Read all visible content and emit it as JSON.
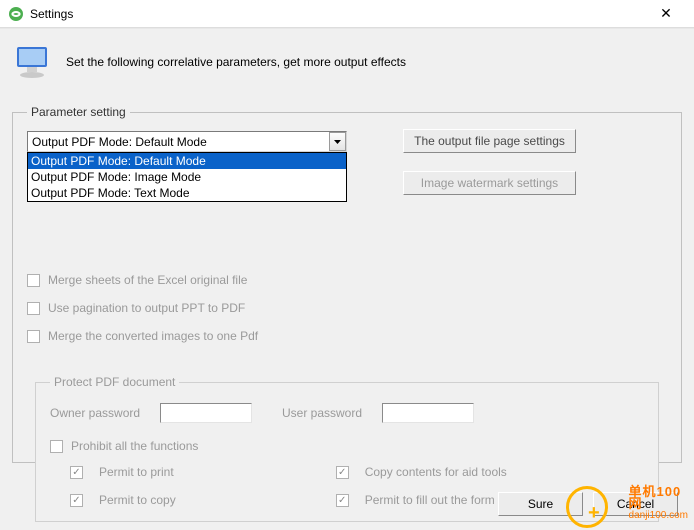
{
  "window": {
    "title": "Settings"
  },
  "header": {
    "description": "Set the following correlative parameters, get more output effects"
  },
  "group": {
    "legend": "Parameter setting",
    "combo": {
      "selected": "Output PDF Mode: Default Mode",
      "options": [
        "Output PDF Mode: Default Mode",
        "Output PDF Mode: Image Mode",
        "Output PDF Mode: Text Mode"
      ]
    },
    "page_settings_btn": "The output file page settings",
    "watermark_btn": "Image watermark settings",
    "checks": {
      "merge_sheets": "Merge sheets of the Excel original file",
      "pagination": "Use pagination to output PPT to PDF",
      "merge_images": "Merge the converted images to one Pdf"
    }
  },
  "protect": {
    "legend": "Protect PDF document",
    "owner_label": "Owner password",
    "user_label": "User password",
    "prohibit": "Prohibit all the functions",
    "permit_print": "Permit to print",
    "permit_copy": "Permit to copy",
    "permit_aid": "Copy contents for aid tools",
    "permit_form": "Permit to fill out the form domain"
  },
  "footer": {
    "sure": "Sure",
    "cancel": "Cancel"
  },
  "watermark": {
    "line1": "单机100网",
    "line2": "danji100.com"
  }
}
